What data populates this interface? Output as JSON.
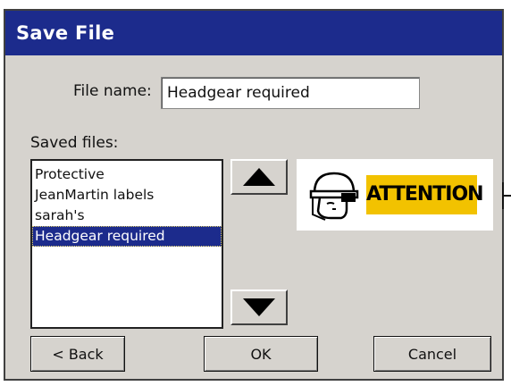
{
  "window": {
    "title": "Save File"
  },
  "filename": {
    "label": "File name:",
    "value": "Headgear required"
  },
  "saved_files": {
    "label": "Saved files:",
    "items": [
      "Protective",
      "JeanMartin labels",
      "sarah's",
      "Headgear required"
    ],
    "selected_index": 3
  },
  "preview": {
    "text": "ATTENTION",
    "icon": "hardhat-faceshield-icon",
    "accent_color": "#f2c200"
  },
  "buttons": {
    "back": "< Back",
    "ok": "OK",
    "cancel": "Cancel"
  },
  "colors": {
    "titlebar": "#1c2b8c",
    "dialog_bg": "#d6d3ce",
    "selection": "#1c2b8c"
  }
}
